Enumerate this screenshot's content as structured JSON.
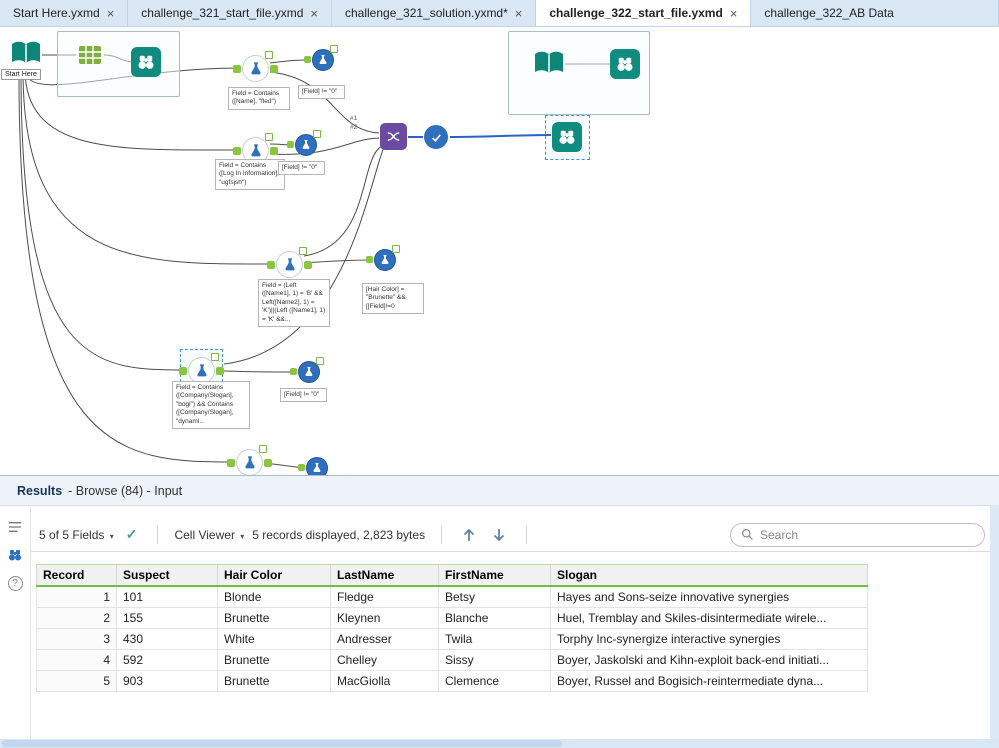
{
  "tabs": [
    {
      "label": "Start Here.yxmd",
      "close": "×"
    },
    {
      "label": "challenge_321_start_file.yxmd",
      "close": "×"
    },
    {
      "label": "challenge_321_solution.yxmd*",
      "close": "×"
    },
    {
      "label": "challenge_322_start_file.yxmd",
      "close": "×"
    },
    {
      "label": "challenge_322_AB Data",
      "close": ""
    }
  ],
  "canvas": {
    "start_here_label": "Start Here",
    "junction1": "#1",
    "junction2": "#2",
    "annotations": [
      {
        "text": "Field = Contains ([Name], \"fled\")"
      },
      {
        "text": "[Field] != \"0\""
      },
      {
        "text": "Field = Contains ([Log In Information], \"ugfsjsh\")"
      },
      {
        "text": "[Field] != \"0\""
      },
      {
        "text": "Field = (Left ([Name1], 1) = 'B' && Left([Name2], 1) = 'K')||(Left ([Name1], 1) = 'K' &&..."
      },
      {
        "text": "[Hair Color] = \"Brunette\" && [[Field]!=0"
      },
      {
        "text": "Field = Contains ([Company/Slogan], \"bogl\") && Contains ([Company/Slogan], \"dynaml..."
      },
      {
        "text": "[Field] != \"0\""
      }
    ]
  },
  "results": {
    "title": "Results",
    "subtitle": "-  Browse (84) - Input",
    "toolbar": {
      "fields_label": "5 of 5 Fields",
      "cell_viewer_label": "Cell Viewer",
      "records_label": "5 records displayed, 2,823 bytes",
      "search_placeholder": "Search"
    },
    "table": {
      "columns": [
        "Record",
        "Suspect",
        "Hair Color",
        "LastName",
        "FirstName",
        "Slogan"
      ],
      "rows": [
        [
          "1",
          "101",
          "Blonde",
          "Fledge",
          "Betsy",
          "Hayes and Sons-seize innovative synergies"
        ],
        [
          "2",
          "155",
          "Brunette",
          "Kleynen",
          "Blanche",
          "Huel, Tremblay and Skiles-disintermediate wirele..."
        ],
        [
          "3",
          "430",
          "White",
          "Andresser",
          "Twila",
          "Torphy Inc-synergize interactive synergies"
        ],
        [
          "4",
          "592",
          "Brunette",
          "Chelley",
          "Sissy",
          "Boyer, Jaskolski and Kihn-exploit back-end initiati..."
        ],
        [
          "5",
          "903",
          "Brunette",
          "MacGiolla",
          "Clemence",
          "Boyer, Russel and Bogisich-reintermediate dyna..."
        ]
      ]
    }
  }
}
